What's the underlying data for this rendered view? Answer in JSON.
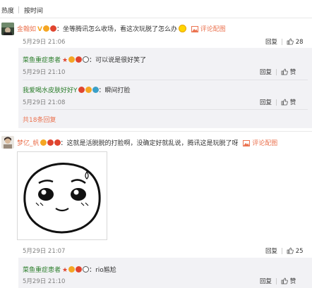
{
  "tabs": {
    "hot": "热度",
    "time": "按时间"
  },
  "comment1": {
    "username": "金翰如",
    "text": "：坐等腾讯怎么收场，看这次玩脱了怎么办",
    "pic_label": "评论配图",
    "time": "5月29日 21:06",
    "reply_label": "回复",
    "like_count": "28",
    "replies": [
      {
        "username": "菜鱼重症患者",
        "text": "：可以说是很好笑了",
        "time": "5月29日 21:10",
        "reply_label": "回复",
        "like_label": "赞"
      },
      {
        "username": "我爱喝水皮肤好好Y",
        "text": "：瞬间打脸",
        "time": "5月29日 21:08",
        "reply_label": "回复",
        "like_label": "赞"
      }
    ],
    "more_replies": "共18条回复"
  },
  "comment2": {
    "username": "梦亿_帆",
    "text": "：这就是活脱脱的打脸啊，没确定好就乱说，腾讯这是玩脱了呀",
    "pic_label": "评论配图",
    "time": "5月29日 21:07",
    "reply_label": "回复",
    "like_count": "25",
    "replies": [
      {
        "username": "菜鱼重症患者",
        "text": "：rio尴尬",
        "time": "5月29日 21:10",
        "reply_label": "回复",
        "like_label": "赞"
      }
    ]
  },
  "colors": {
    "accent": "#eb7350",
    "reply_bg": "#f2f2f5",
    "muted": "#808080"
  }
}
